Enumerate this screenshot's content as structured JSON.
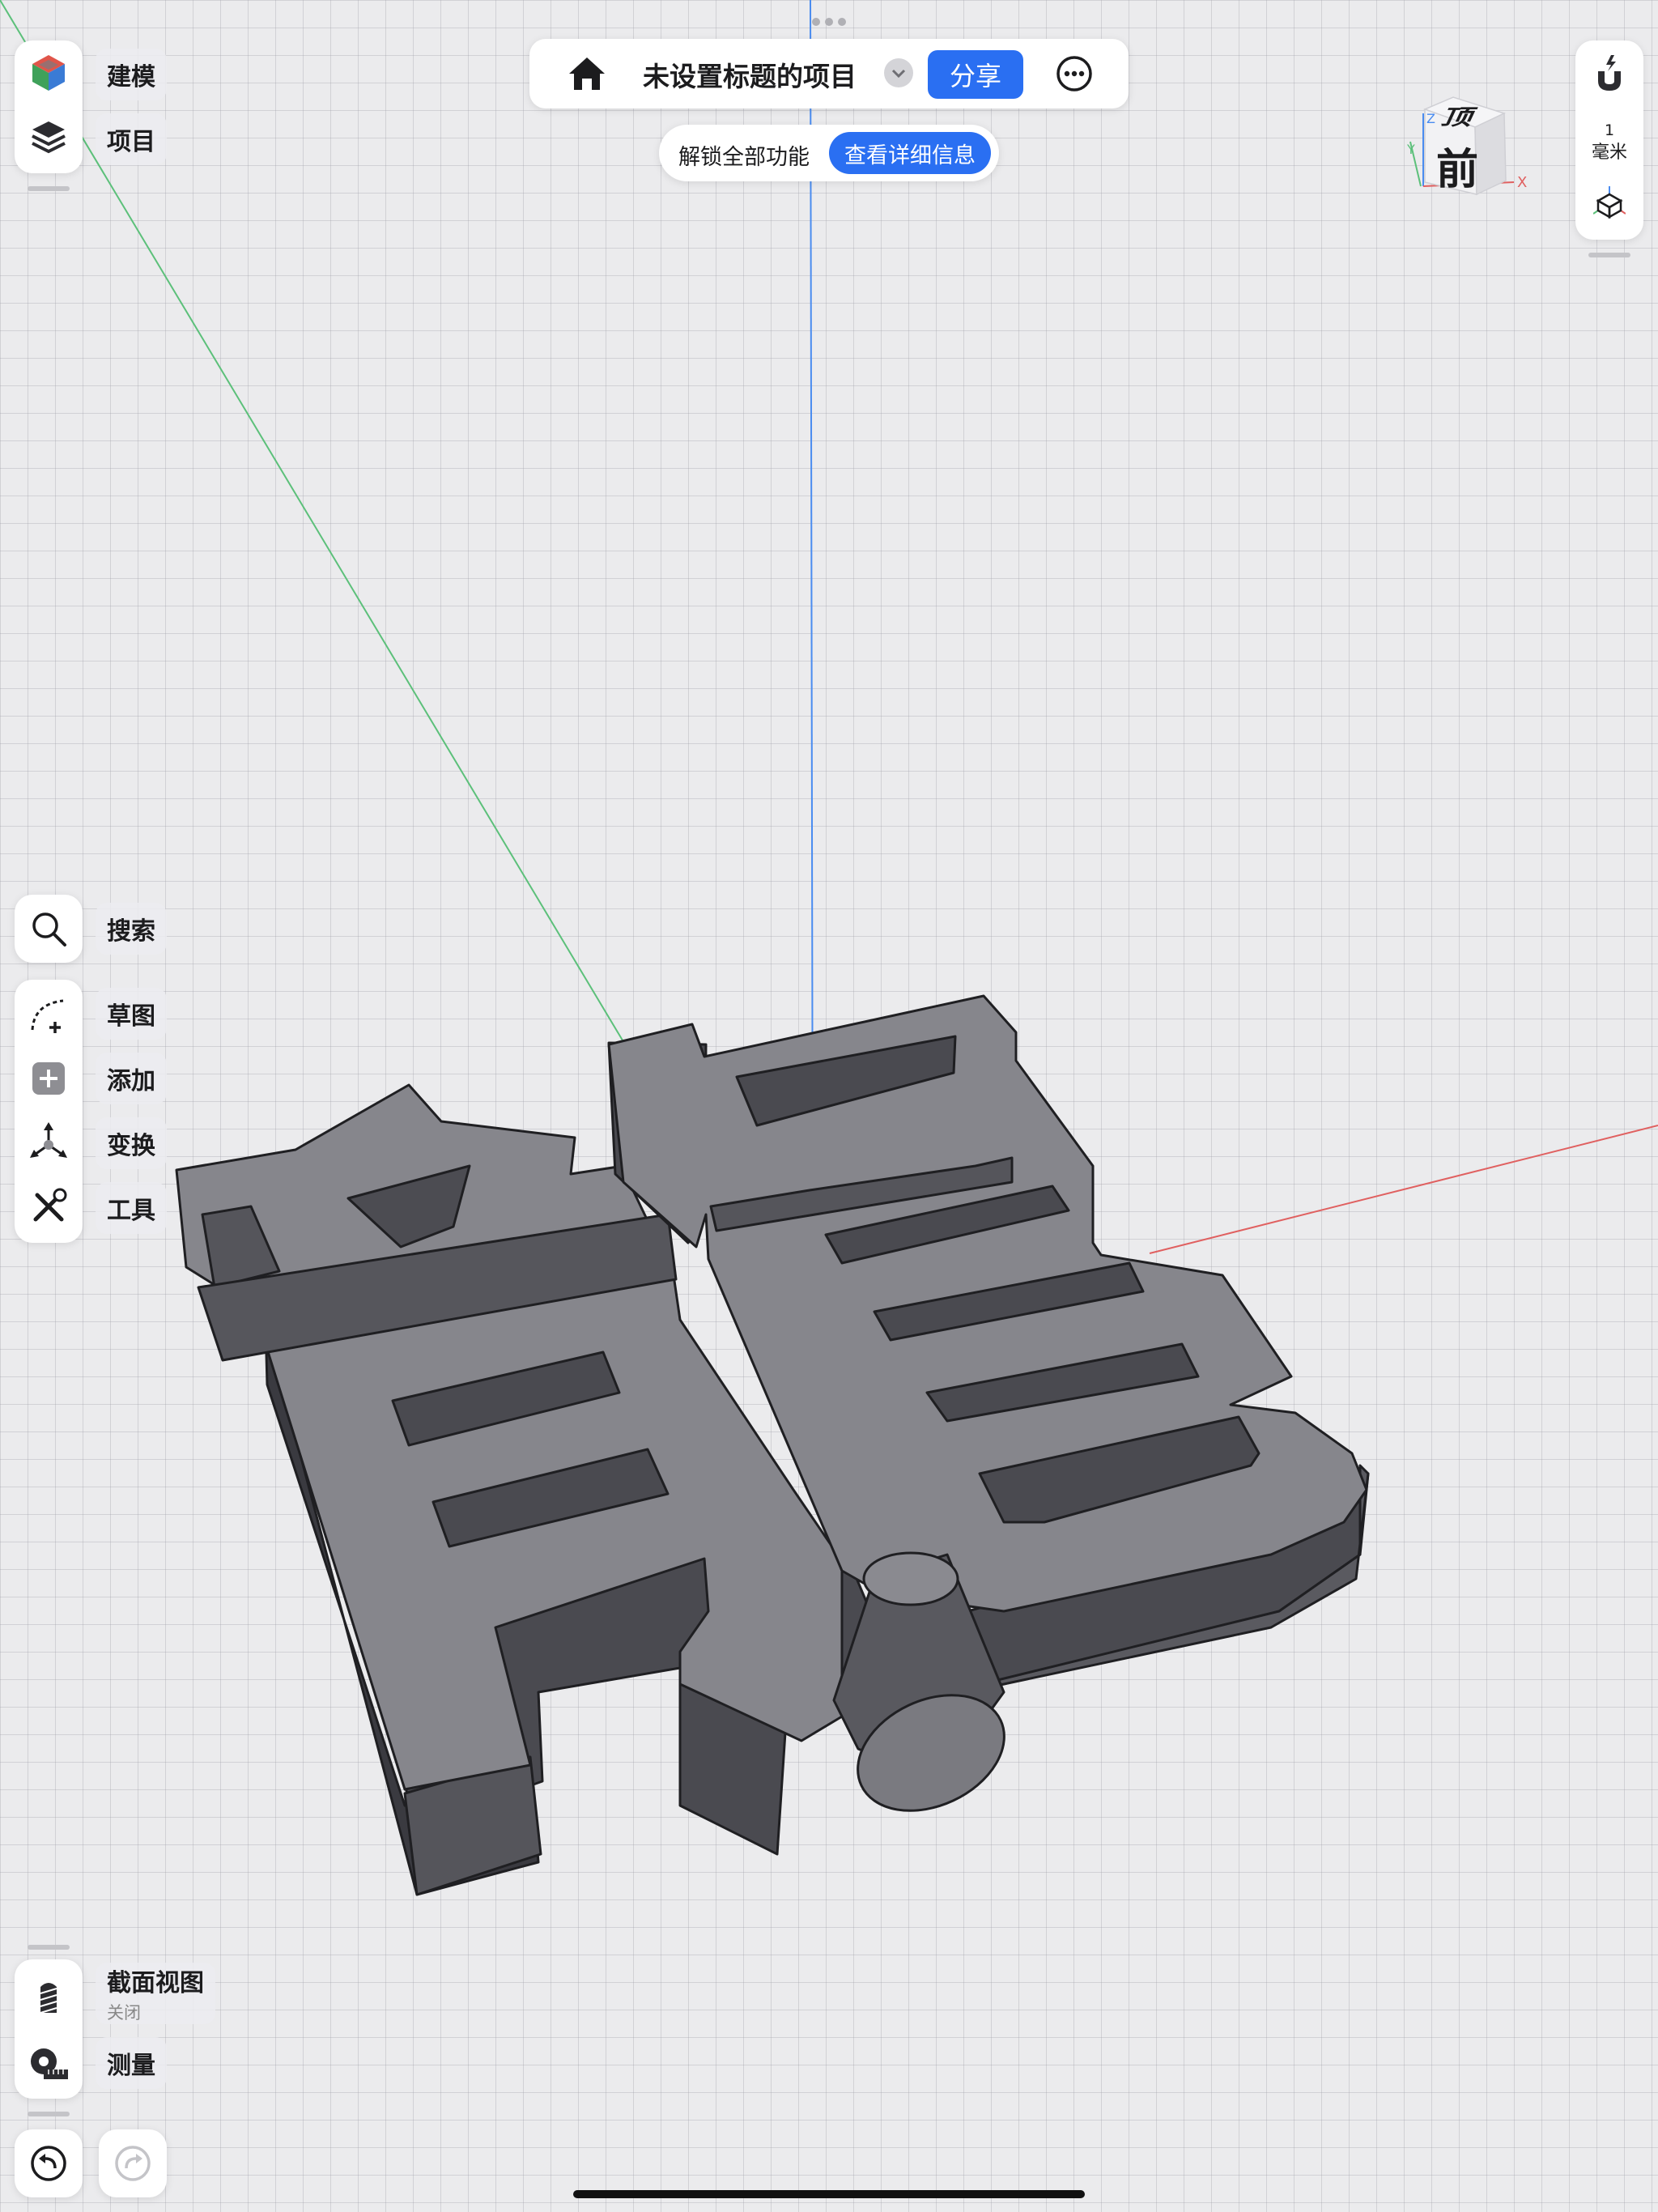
{
  "app": {
    "project_title": "未设置标题的项目",
    "share_label": "分享",
    "unlock_text": "解锁全部功能",
    "details_label": "查看详细信息"
  },
  "left_top_tools": [
    {
      "label": "建模",
      "icon": "modeling-cube-icon"
    },
    {
      "label": "项目",
      "icon": "layers-icon"
    }
  ],
  "left_mid_tools": {
    "search": {
      "label": "搜索",
      "icon": "search-icon"
    },
    "sketch": {
      "label": "草图",
      "icon": "sketch-icon"
    },
    "add": {
      "label": "添加",
      "icon": "plus-icon"
    },
    "transform": {
      "label": "变换",
      "icon": "transform-icon"
    },
    "tools": {
      "label": "工具",
      "icon": "wrench-icon"
    }
  },
  "left_bottom_tools": {
    "section": {
      "label": "截面视图",
      "sub": "关闭",
      "icon": "section-view-icon"
    },
    "measure": {
      "label": "测量",
      "icon": "tape-measure-icon"
    }
  },
  "right_panel": {
    "unit_value": "1",
    "unit_label": "毫米"
  },
  "view_cube": {
    "top": "顶",
    "front": "前",
    "axis_x": "X",
    "axis_y": "Y",
    "axis_z": "Z"
  },
  "colors": {
    "accent": "#2a6ff2",
    "model_top": "#86868c",
    "model_side": "#5a5a60",
    "axis_x": "#e06060",
    "axis_y": "#5cc07a",
    "axis_z": "#4a8cf0"
  }
}
